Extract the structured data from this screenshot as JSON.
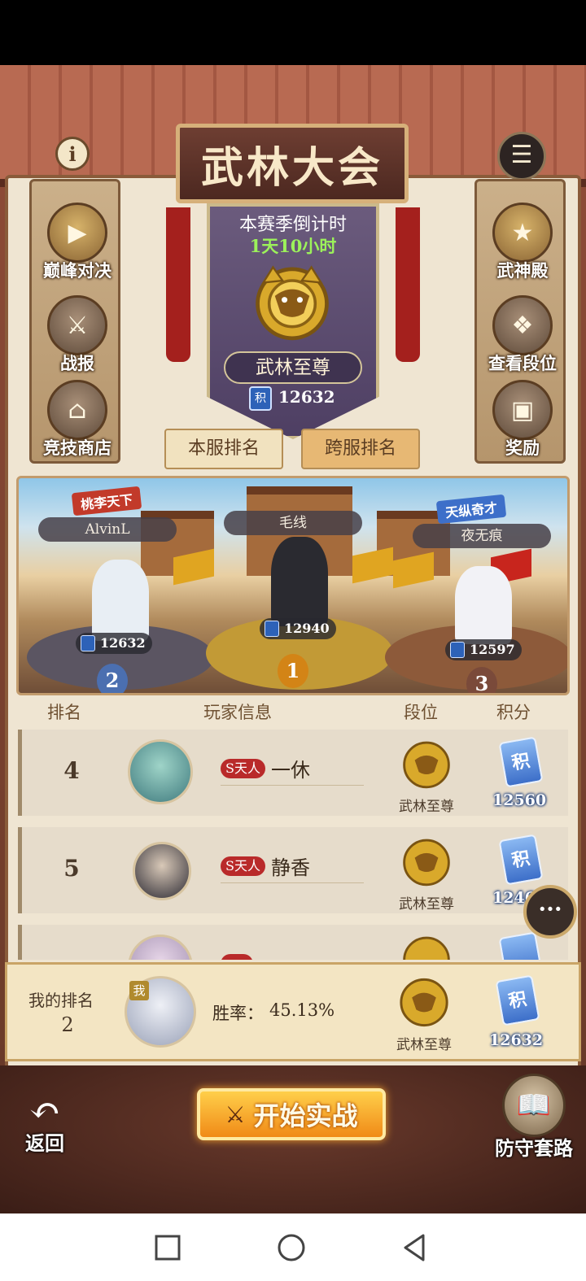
{
  "game_title": "武林大会",
  "season": {
    "countdown_label": "本赛季倒计时",
    "countdown_value": "1天10小时",
    "rank_name": "武林至尊",
    "score": "12632",
    "score_icon_text": "积"
  },
  "left_menu": [
    {
      "label": "巅峰对决",
      "icon": "play-icon"
    },
    {
      "label": "战报",
      "icon": "crossed-swords-icon"
    },
    {
      "label": "竞技商店",
      "icon": "shop-icon"
    }
  ],
  "right_menu": [
    {
      "label": "武神殿",
      "icon": "temple-icon"
    },
    {
      "label": "查看段位",
      "icon": "dragon-icon"
    },
    {
      "label": "奖励",
      "icon": "chest-icon"
    }
  ],
  "cross_server": {
    "label": "跨服",
    "icon": "list-icon"
  },
  "info_icon_text": "i",
  "tabs": {
    "local": "本服排名",
    "cross": "跨服排名",
    "selected": "cross"
  },
  "podium": {
    "first": {
      "name": "毛线",
      "score": "12940",
      "place": "1"
    },
    "second": {
      "name": "AlvinL",
      "score": "12632",
      "place": "2",
      "badge": "桃李天下"
    },
    "third": {
      "name": "夜无痕",
      "score": "12597",
      "place": "3",
      "badge": "天纵奇才"
    }
  },
  "table_header": {
    "rank": "排名",
    "player": "玩家信息",
    "tier": "段位",
    "score": "积分"
  },
  "rows": [
    {
      "rank": "4",
      "title": "S天人",
      "name": "一休",
      "tier": "武林至尊",
      "score": "12560"
    },
    {
      "rank": "5",
      "title": "S天人",
      "name": "静香",
      "tier": "武林至尊",
      "score": "1246"
    },
    {
      "rank": "",
      "title": "",
      "name": "",
      "tier": "",
      "score": ""
    }
  ],
  "my_rank": {
    "label": "我的排名",
    "value": "2",
    "me_tag": "我",
    "winrate_label": "胜率：",
    "winrate": "45.13%",
    "tier": "武林至尊",
    "score": "12632"
  },
  "chat_icon_text": "···",
  "bottom": {
    "back_label": "返回",
    "start_label": "开始实战",
    "defense_label": "防守套路"
  },
  "colors": {
    "countdown": "#9cf25a",
    "selected_tab": "#e7b874",
    "start_button": "#f08a17",
    "title_badge": "#b92a2a"
  }
}
